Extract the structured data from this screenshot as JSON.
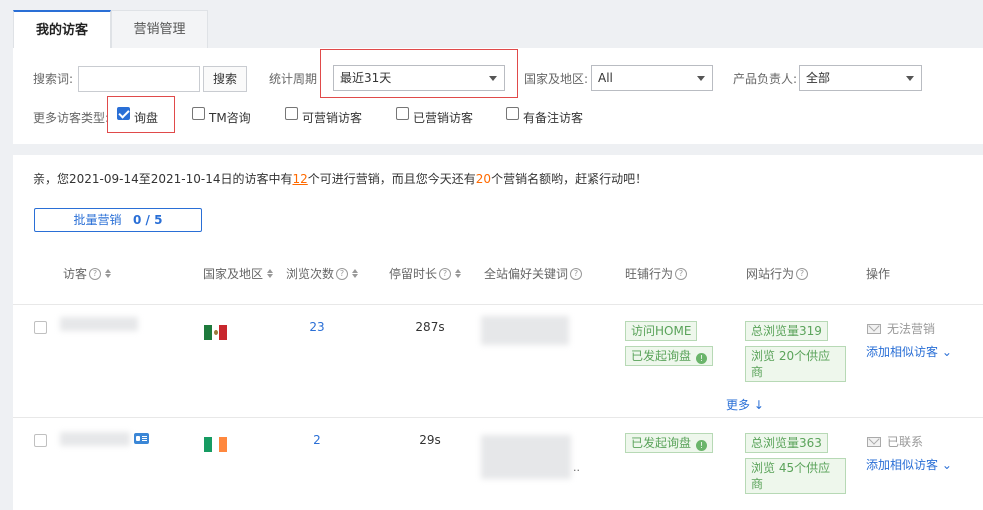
{
  "tabs": [
    {
      "label": "我的访客",
      "active": true
    },
    {
      "label": "营销管理",
      "active": false
    }
  ],
  "filters": {
    "search_label": "搜索词:",
    "search_value": "",
    "search_button": "搜索",
    "period_label": "统计周期",
    "period_value": "最近31天",
    "region_label": "国家及地区:",
    "region_value": "All",
    "owner_label": "产品负责人:",
    "owner_value": "全部",
    "more_types_label": "更多访客类型:",
    "types": [
      {
        "label": "询盘",
        "checked": true
      },
      {
        "label": "TM咨询",
        "checked": false
      },
      {
        "label": "可营销访客",
        "checked": false
      },
      {
        "label": "已营销访客",
        "checked": false
      },
      {
        "label": "有备注访客",
        "checked": false
      }
    ]
  },
  "notice": {
    "p1": "亲，您2021-09-14至2021-10-14日的访客中有",
    "count1": "12",
    "p2": "个可进行营销，而且您今天还有",
    "count2": "20",
    "p3": "个营销名额哟，赶紧行动吧！"
  },
  "bulk": {
    "label": "批量营销",
    "count": "0 / 5"
  },
  "columns": {
    "visitor": "访客",
    "region": "国家及地区",
    "views": "浏览次数",
    "stay": "停留时长",
    "keywords": "全站偏好关键词",
    "shop": "旺铺行为",
    "site": "网站行为",
    "ops": "操作"
  },
  "help_glyph": "?",
  "rows": [
    {
      "country": "Mexico",
      "views": "23",
      "stay": "287s",
      "shop_tags": [
        "访问HOME",
        "已发起询盘"
      ],
      "site_total": "总浏览量319",
      "site_browse": "浏览 20个供应商",
      "op_status": "无法营销",
      "op_link": "添加相似访客"
    },
    {
      "country": "Ireland",
      "views": "2",
      "stay": "29s",
      "shop_tags": [
        "已发起询盘"
      ],
      "site_total": "总浏览量363",
      "site_browse": "浏览 45个供应商",
      "op_status": "已联系",
      "op_link": "添加相似访客",
      "keyword_ellipsis": ".."
    }
  ],
  "more_link": "更多",
  "colors": {
    "accent": "#2a6fd6",
    "highlight": "#ff6a00",
    "tag_green": "#5aa35a",
    "annotation_red": "#e04a4a"
  }
}
